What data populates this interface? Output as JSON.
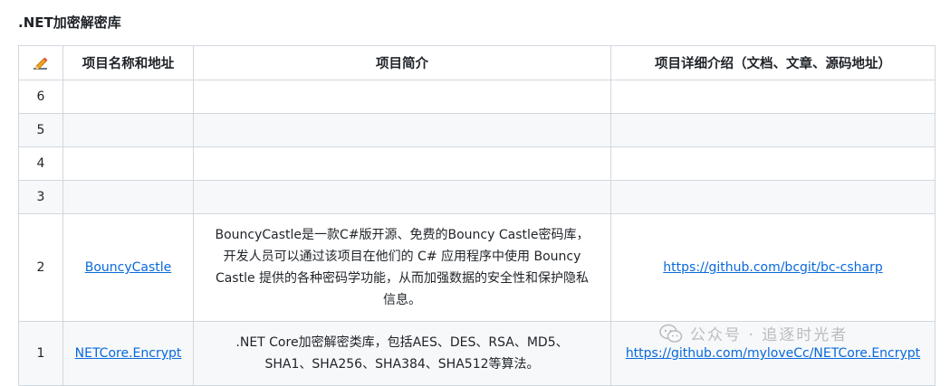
{
  "title": ".NET加密解密库",
  "table": {
    "headers": {
      "icon": "pencil-icon",
      "name": "项目名称和地址",
      "intro": "项目简介",
      "detail": "项目详细介绍（文档、文章、源码地址）"
    },
    "rows": [
      {
        "num": "6",
        "name": "",
        "intro": "",
        "detail": ""
      },
      {
        "num": "5",
        "name": "",
        "intro": "",
        "detail": ""
      },
      {
        "num": "4",
        "name": "",
        "intro": "",
        "detail": ""
      },
      {
        "num": "3",
        "name": "",
        "intro": "",
        "detail": ""
      },
      {
        "num": "2",
        "name": "BouncyCastle",
        "intro": "BouncyCastle是一款C#版开源、免费的Bouncy Castle密码库，开发人员可以通过该项目在他们的 C# 应用程序中使用 Bouncy Castle 提供的各种密码学功能，从而加强数据的安全性和保护隐私信息。",
        "detail": "https://github.com/bcgit/bc-csharp"
      },
      {
        "num": "1",
        "name": "NETCore.Encrypt",
        "intro": ".NET Core加密解密类库，包括AES、DES、RSA、MD5、SHA1、SHA256、SHA384、SHA512等算法。",
        "detail": "https://github.com/myloveCc/NETCore.Encrypt"
      }
    ]
  },
  "watermark": {
    "text": "公众号 · 追逐时光者",
    "icon": "wechat-icon"
  },
  "colors": {
    "link": "#0969da",
    "border": "#d0d7de",
    "stripe": "#f6f8fa"
  }
}
